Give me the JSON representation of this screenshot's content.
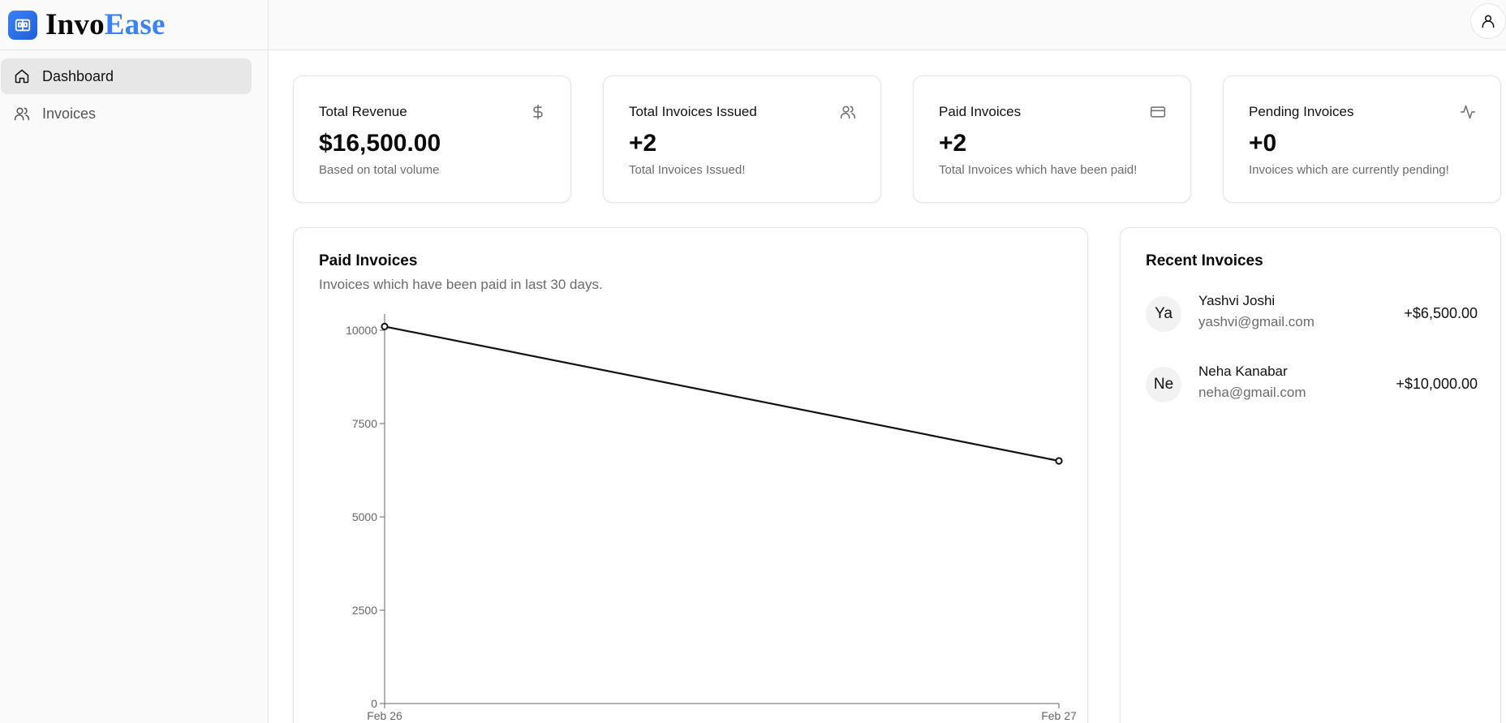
{
  "brand": {
    "name_part1": "Invo",
    "name_part2": "Ease"
  },
  "sidebar": {
    "items": [
      {
        "label": "Dashboard",
        "icon": "home-icon",
        "active": true
      },
      {
        "label": "Invoices",
        "icon": "users-icon",
        "active": false
      }
    ]
  },
  "header": {
    "user_icon": "user-icon"
  },
  "stats": [
    {
      "title": "Total Revenue",
      "value": "$16,500.00",
      "subtitle": "Based on total volume",
      "icon": "dollar-icon"
    },
    {
      "title": "Total Invoices Issued",
      "value": "+2",
      "subtitle": "Total Invoices Issued!",
      "icon": "users-icon"
    },
    {
      "title": "Paid Invoices",
      "value": "+2",
      "subtitle": "Total Invoices which have been paid!",
      "icon": "credit-card-icon"
    },
    {
      "title": "Pending Invoices",
      "value": "+0",
      "subtitle": "Invoices which are currently pending!",
      "icon": "activity-icon"
    }
  ],
  "chart_card": {
    "title": "Paid Invoices",
    "subtitle": "Invoices which have been paid in last 30 days."
  },
  "chart_data": {
    "type": "line",
    "x": [
      "Feb 26",
      "Feb 27"
    ],
    "series": [
      {
        "values": [
          10100,
          6500
        ]
      }
    ],
    "yticks": [
      0,
      2500,
      5000,
      7500,
      10000
    ],
    "ylim": [
      0,
      10000
    ],
    "grid": false,
    "line_color": "#111111"
  },
  "recent": {
    "title": "Recent Invoices",
    "items": [
      {
        "initials": "Ya",
        "name": "Yashvi Joshi",
        "email": "yashvi@gmail.com",
        "amount": "+$6,500.00"
      },
      {
        "initials": "Ne",
        "name": "Neha Kanabar",
        "email": "neha@gmail.com",
        "amount": "+$10,000.00"
      }
    ]
  },
  "colors": {
    "accent": "#3b82f6",
    "sidebar_bg": "#fafafa",
    "active_item_bg": "#e7e7e7"
  }
}
